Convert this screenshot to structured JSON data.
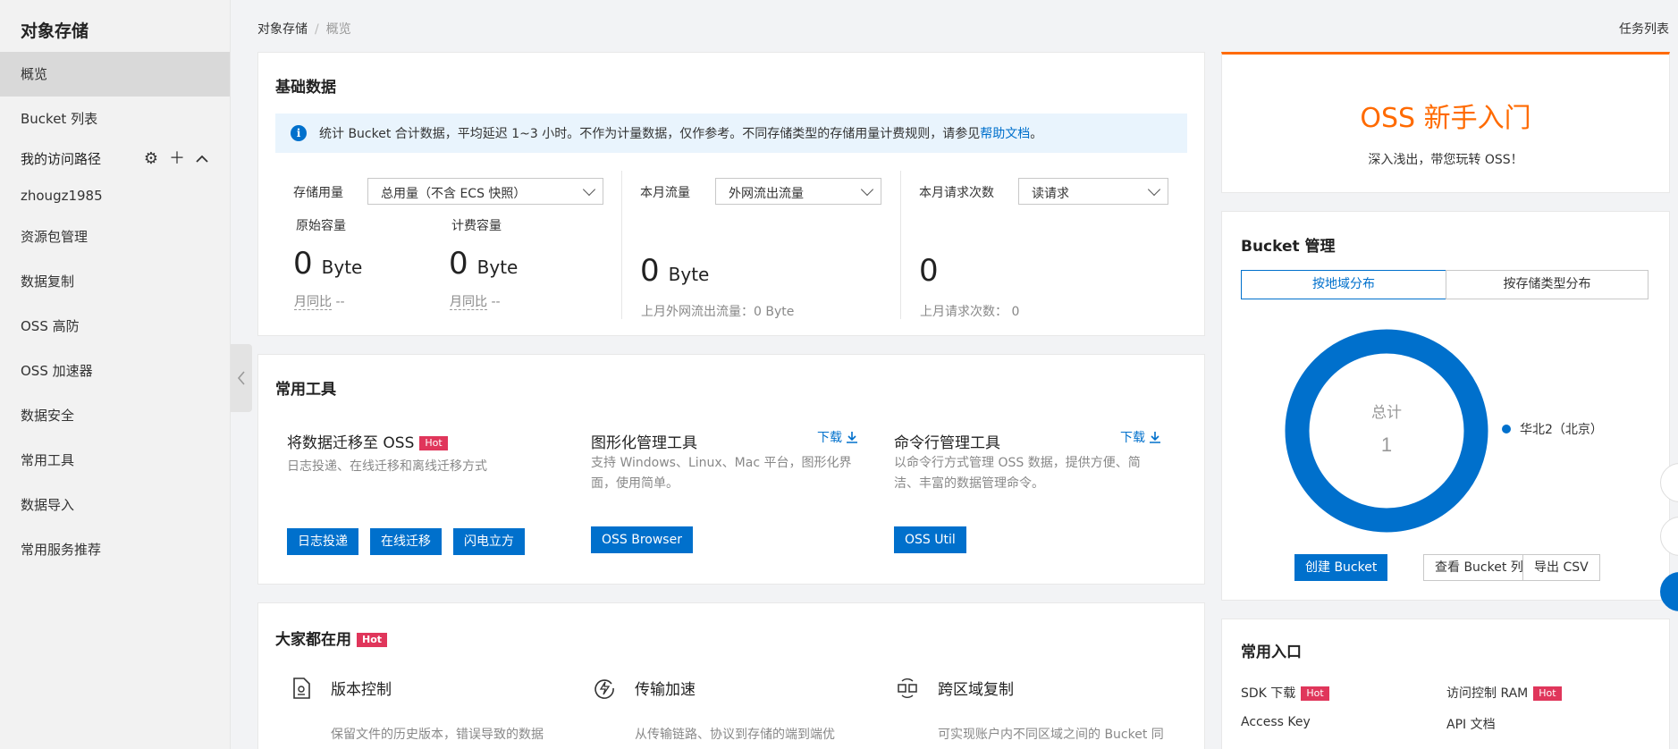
{
  "sidebar": {
    "title": "对象存储",
    "items": [
      "概览",
      "Bucket 列表"
    ],
    "group_label": "我的访问路径",
    "group_items": [
      "zhougz1985",
      "资源包管理",
      "数据复制",
      "OSS 高防",
      "OSS 加速器",
      "数据安全",
      "常用工具",
      "数据导入",
      "常用服务推荐"
    ]
  },
  "breadcrumb": {
    "root": "对象存储",
    "separator": "/",
    "current": "概览"
  },
  "header": {
    "task_list": "任务列表"
  },
  "basic": {
    "title": "基础数据",
    "notice_text": "统计 Bucket 合计数据，平均延迟 1~3 小时。不作为计量数据，仅作参考。不同存储类型的存储用量计费规则，请参见",
    "notice_link": "帮助文档",
    "notice_end": "。",
    "storage": {
      "label": "存储用量",
      "select": "总用量（不含 ECS 快照）",
      "orig_label": "原始容量",
      "orig_value": "0",
      "orig_unit": "Byte",
      "orig_mom": "月同比",
      "orig_mom_val": "--",
      "bill_label": "计费容量",
      "bill_value": "0",
      "bill_unit": "Byte",
      "bill_mom": "月同比",
      "bill_mom_val": "--"
    },
    "traffic": {
      "label": "本月流量",
      "select": "外网流出流量",
      "value": "0",
      "unit": "Byte",
      "last": "上月外网流出流量：0 Byte"
    },
    "requests": {
      "label": "本月请求次数",
      "select": "读请求",
      "value": "0",
      "last": "上月请求次数：  0"
    }
  },
  "tools": {
    "title": "常用工具",
    "migrate": {
      "title": "将数据迁移至 OSS",
      "badge": "Hot",
      "desc": "日志投递、在线迁移和离线迁移方式",
      "buttons": [
        "日志投递",
        "在线迁移",
        "闪电立方"
      ]
    },
    "gui": {
      "title": "图形化管理工具",
      "download": "下载",
      "desc1": "支持 Windows、Linux、Mac 平台，图形化界",
      "desc2": "面，使用简单。",
      "button": "OSS Browser"
    },
    "cli": {
      "title": "命令行管理工具",
      "download": "下载",
      "desc1": "以命令行方式管理 OSS 数据，提供方便、简",
      "desc2": "洁、丰富的数据管理命令。",
      "button": "OSS Util"
    }
  },
  "popular": {
    "title": "大家都在用",
    "badge": "Hot",
    "items": [
      {
        "title": "版本控制",
        "desc": "保留文件的历史版本，错误导致的数据"
      },
      {
        "title": "传输加速",
        "desc": "从传输链路、协议到存储的端到端优"
      },
      {
        "title": "跨区域复制",
        "desc": "可实现账户内不同区域之间的 Bucket 同"
      }
    ]
  },
  "guide": {
    "title": "OSS 新手入门",
    "subtitle": "深入浅出，带您玩转 OSS！"
  },
  "bucket": {
    "title": "Bucket 管理",
    "tabs": [
      "按地域分布",
      "按存储类型分布"
    ],
    "total_label": "总计",
    "total_value": "1",
    "legend": "华北2（北京）",
    "buttons": {
      "create": "创建 Bucket",
      "view": "查看 Bucket 列表",
      "export": "导出 CSV"
    },
    "color": "#0070cc"
  },
  "entry": {
    "title": "常用入口",
    "items": [
      {
        "label": "SDK 下载",
        "hot": "Hot"
      },
      {
        "label": "访问控制 RAM",
        "hot": "Hot"
      },
      {
        "label": "Access Key",
        "hot": ""
      },
      {
        "label": "API 文档",
        "hot": ""
      }
    ]
  }
}
